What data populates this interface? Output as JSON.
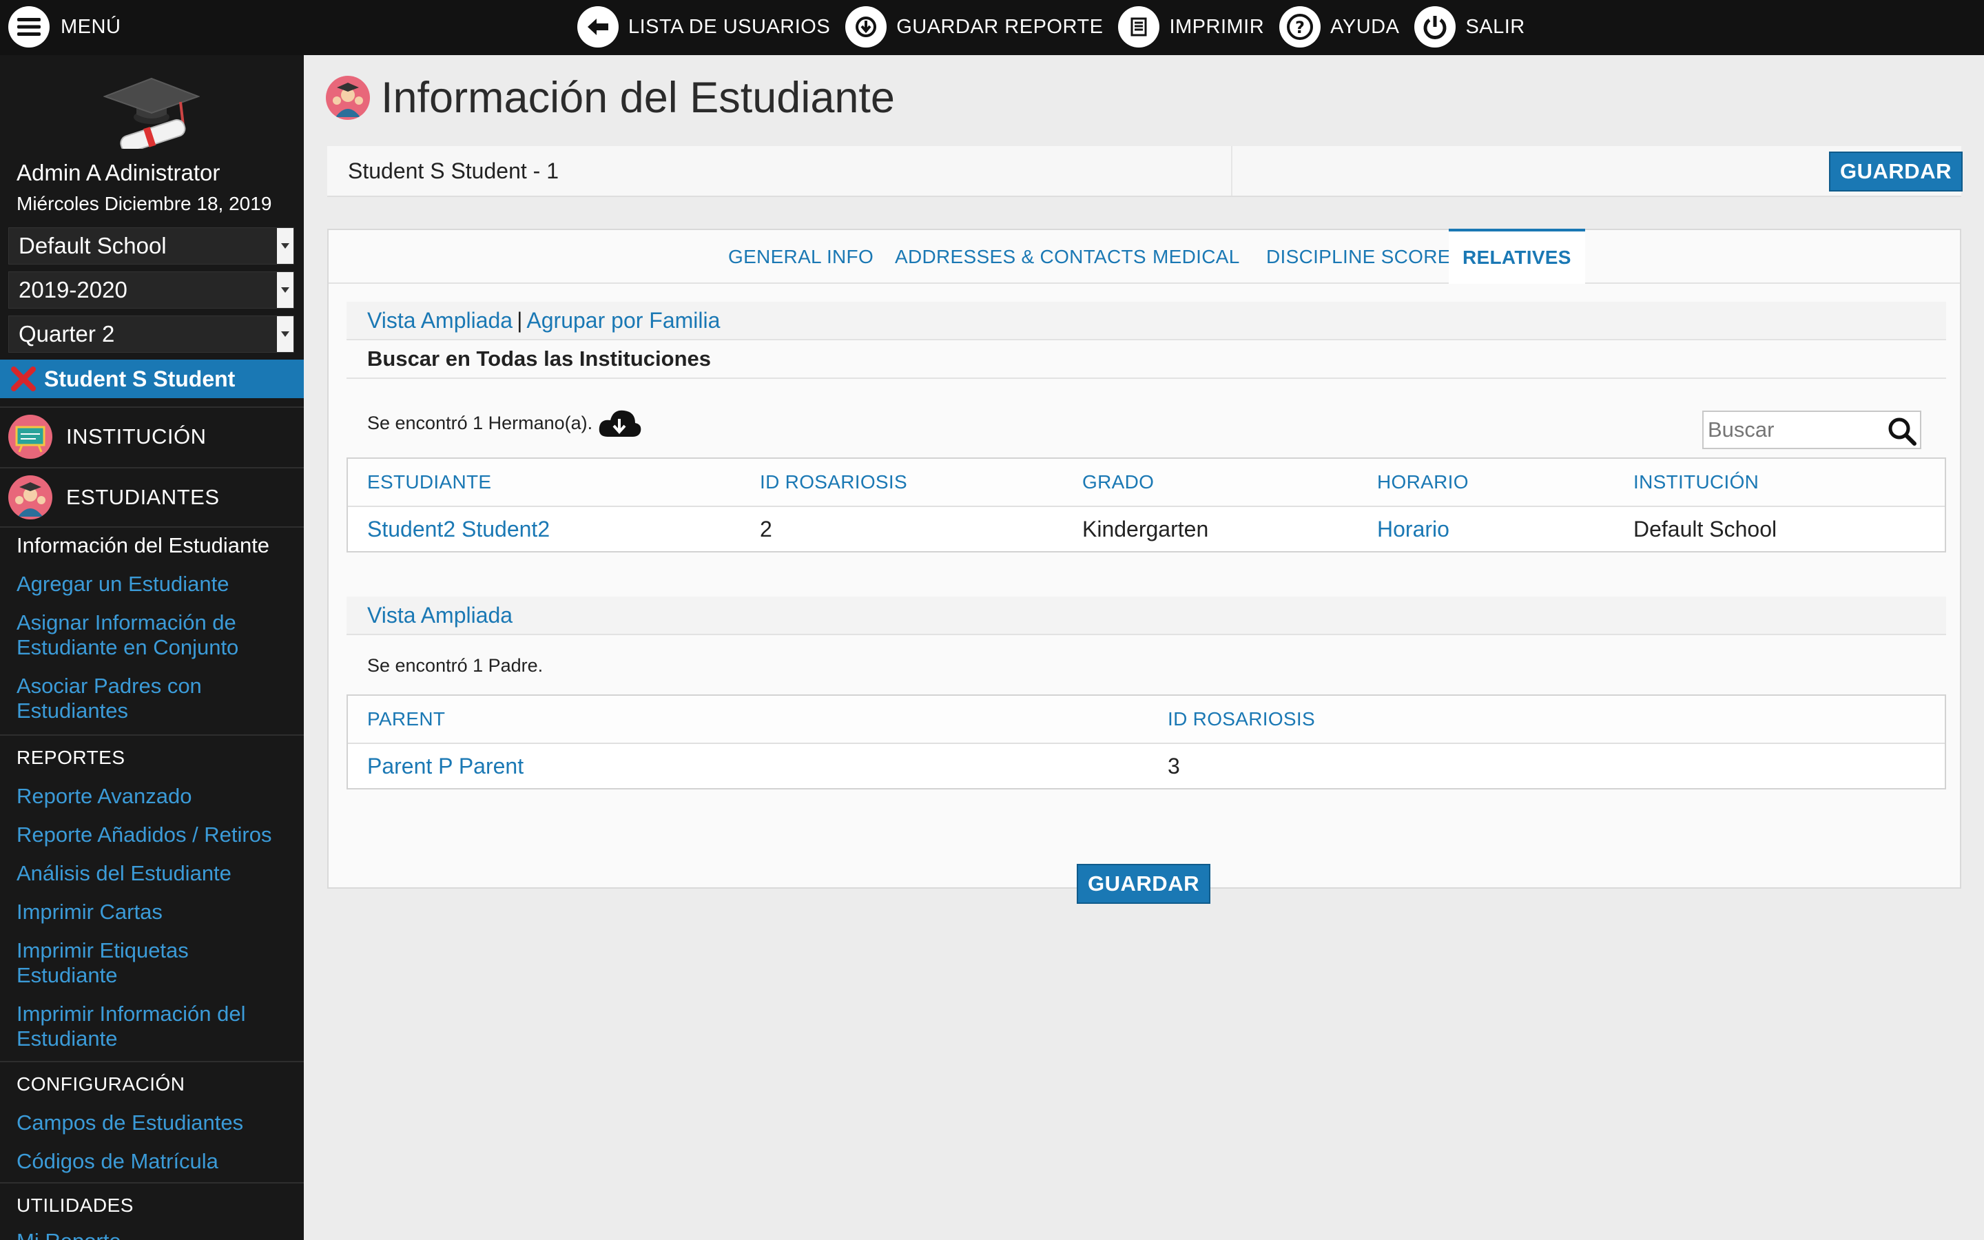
{
  "topbar": {
    "menu_label": "MENÚ",
    "actions": [
      {
        "label": "LISTA DE USUARIOS",
        "icon": "arrow-left-icon"
      },
      {
        "label": "GUARDAR REPORTE",
        "icon": "download-icon"
      },
      {
        "label": "IMPRIMIR",
        "icon": "print-icon"
      },
      {
        "label": "AYUDA",
        "icon": "help-icon"
      },
      {
        "label": "SALIR",
        "icon": "power-icon"
      }
    ]
  },
  "sidebar": {
    "user_name": "Admin A Adinistrator",
    "date": "Miércoles Diciembre 18, 2019",
    "school": "Default School",
    "year": "2019-2020",
    "period": "Quarter 2",
    "current_student": "Student S Student",
    "cat_institucion": "INSTITUCIÓN",
    "cat_estudiantes": "ESTUDIANTES",
    "links": [
      "Información del Estudiante",
      "Agregar un Estudiante",
      "Asignar Información de Estudiante en Conjunto",
      "Asociar Padres con Estudiantes"
    ],
    "reportes_head": "REPORTES",
    "reportes": [
      "Reporte Avanzado",
      "Reporte Añadidos / Retiros",
      "Análisis del Estudiante",
      "Imprimir Cartas",
      "Imprimir Etiquetas Estudiante",
      "Imprimir Información del Estudiante"
    ],
    "config_head": "CONFIGURACIÓN",
    "config": [
      "Campos de Estudiantes",
      "Códigos de Matrícula"
    ],
    "util_head": "UTILIDADES",
    "util": [
      "Mi Reporte"
    ]
  },
  "main": {
    "title": "Información del Estudiante",
    "student_label": "Student S Student - 1",
    "save_label": "GUARDAR",
    "tabs": [
      "GENERAL INFO",
      "ADDRESSES & CONTACTS",
      "MEDICAL",
      "DISCIPLINE SCORE",
      "RELATIVES"
    ],
    "siblings": {
      "link_expanded": "Vista Ampliada",
      "separator": "|",
      "link_group": "Agrupar por Familia",
      "search_all": "Buscar en Todas las Instituciones",
      "found": "Se encontró 1 Hermano(a).",
      "search_placeholder": "Buscar",
      "columns": [
        "ESTUDIANTE",
        "ID ROSARIOSIS",
        "GRADO",
        "HORARIO",
        "INSTITUCIÓN"
      ],
      "rows": [
        [
          "Student2 Student2",
          "2",
          "Kindergarten",
          "Horario",
          "Default School"
        ]
      ]
    },
    "parents": {
      "link_expanded": "Vista Ampliada",
      "found": "Se encontró 1 Padre.",
      "columns": [
        "PARENT",
        "ID ROSARIOSIS"
      ],
      "rows": [
        [
          "Parent P Parent",
          "3"
        ]
      ]
    },
    "bottom_save_label": "GUARDAR"
  },
  "colors": {
    "accent": "#1a78b4",
    "topbar": "#121212",
    "sidebar": "#181818",
    "link": "#3b9bd8"
  }
}
